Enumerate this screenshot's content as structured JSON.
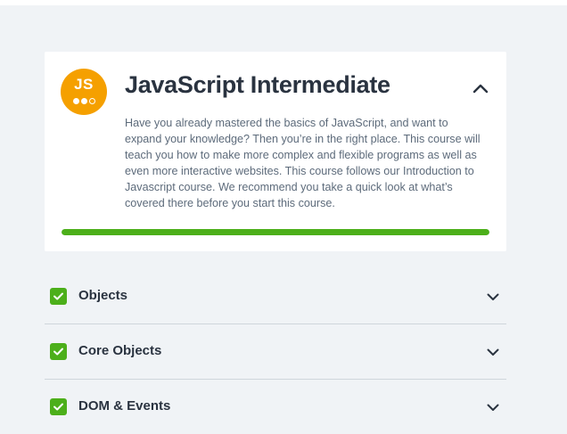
{
  "course": {
    "badge_text": "JS",
    "badge_icon": "js-course-badge-icon",
    "title": "JavaScript Intermediate",
    "description": "Have you already mastered the basics of JavaScript, and want to expand your knowledge? Then you’re in the right place. This course will teach you how to make more complex and flexible programs as well as even more interactive websites. This course follows our Introduction to Javascript course. We recommend you take a quick look at what’s covered there before you start this course.",
    "progress": 1.0,
    "collapse_icon": "chevron-up-icon"
  },
  "modules": [
    {
      "title": "Objects",
      "completed": true,
      "check_icon": "check-icon",
      "expand_icon": "chevron-down-icon"
    },
    {
      "title": "Core Objects",
      "completed": true,
      "check_icon": "check-icon",
      "expand_icon": "chevron-down-icon"
    },
    {
      "title": "DOM & Events",
      "completed": true,
      "check_icon": "check-icon",
      "expand_icon": "chevron-down-icon"
    }
  ],
  "colors": {
    "accent": "#4caf1a",
    "badge": "#f5a000",
    "background": "#f0f3f6",
    "text": "#2a3340"
  }
}
